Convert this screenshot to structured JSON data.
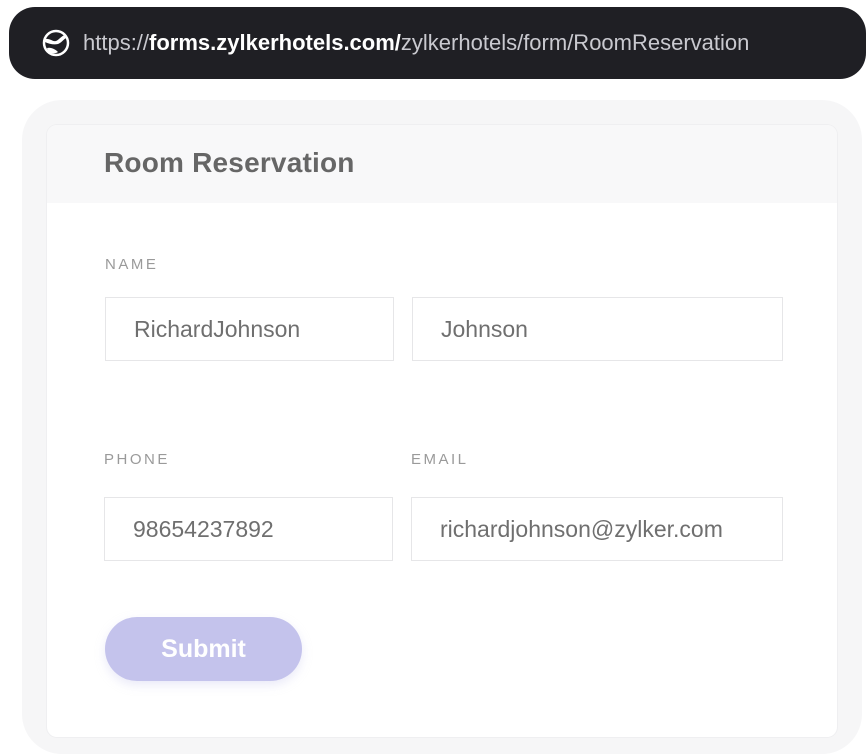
{
  "browser": {
    "url_protocol": "https://",
    "url_domain": "forms.zylkerhotels.com/",
    "url_path": "zylkerhotels/form/RoomReservation",
    "icon": "globe-icon"
  },
  "form": {
    "title": "Room Reservation",
    "name": {
      "label": "NAME",
      "first_value": "RichardJohnson",
      "last_value": "Johnson"
    },
    "phone": {
      "label": "PHONE",
      "value": "98654237892"
    },
    "email": {
      "label": "EMAIL",
      "value": "richardjohnson@zylker.com"
    },
    "submit_label": "Submit"
  },
  "colors": {
    "url_bar_bg": "#1f1f24",
    "submit_bg": "#c4c3ec"
  }
}
